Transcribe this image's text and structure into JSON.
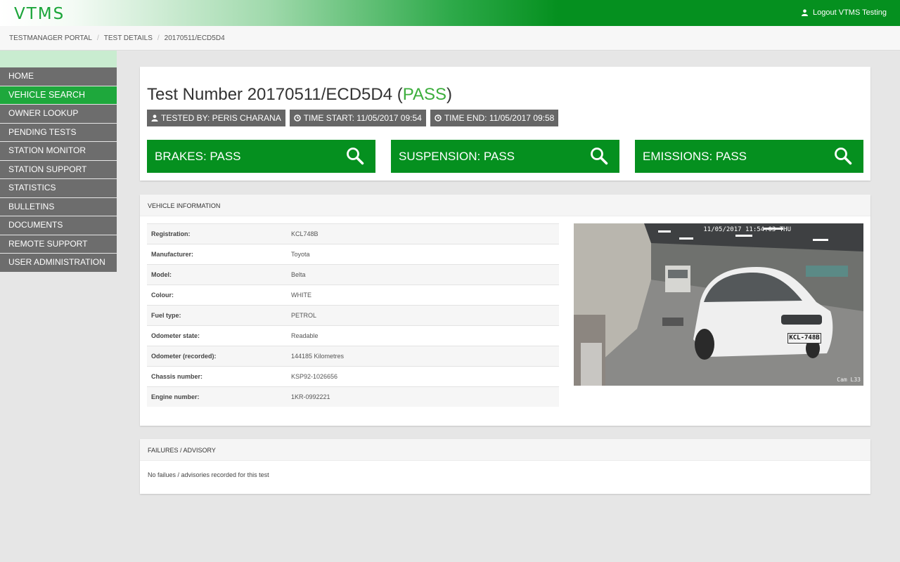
{
  "app": {
    "logo": "VTMS",
    "logout": "Logout VTMS Testing"
  },
  "breadcrumb": [
    "TESTMANAGER PORTAL",
    "TEST DETAILS",
    "20170511/ECD5D4"
  ],
  "sidebar": {
    "items": [
      {
        "label": "HOME",
        "active": false
      },
      {
        "label": "VEHICLE SEARCH",
        "active": true
      },
      {
        "label": "OWNER LOOKUP",
        "active": false
      },
      {
        "label": "PENDING TESTS",
        "active": false
      },
      {
        "label": "STATION MONITOR",
        "active": false
      },
      {
        "label": "STATION SUPPORT",
        "active": false
      },
      {
        "label": "STATISTICS",
        "active": false
      },
      {
        "label": "BULLETINS",
        "active": false
      },
      {
        "label": "DOCUMENTS",
        "active": false
      },
      {
        "label": "REMOTE SUPPORT",
        "active": false
      },
      {
        "label": "USER ADMINISTRATION",
        "active": false
      }
    ]
  },
  "test": {
    "title_prefix": "Test Number 20170511/ECD5D4 (",
    "status": "PASS",
    "title_suffix": ")",
    "tested_by": "TESTED BY: PERIS CHARANA",
    "time_start": "TIME START: 11/05/2017 09:54",
    "time_end": "TIME END: 11/05/2017 09:58",
    "results": [
      {
        "label": "BRAKES: PASS"
      },
      {
        "label": "SUSPENSION: PASS"
      },
      {
        "label": "EMISSIONS: PASS"
      }
    ]
  },
  "vehicle": {
    "header": "VEHICLE INFORMATION",
    "rows": [
      {
        "key": "Registration:",
        "value": "KCL748B"
      },
      {
        "key": "Manufacturer:",
        "value": "Toyota"
      },
      {
        "key": "Model:",
        "value": "Belta"
      },
      {
        "key": "Colour:",
        "value": "WHITE"
      },
      {
        "key": "Fuel type:",
        "value": "PETROL"
      },
      {
        "key": "Odometer state:",
        "value": "Readable"
      },
      {
        "key": "Odometer (recorded):",
        "value": "144185 Kilometres"
      },
      {
        "key": "Chassis number:",
        "value": "KSP92-1026656"
      },
      {
        "key": "Engine number:",
        "value": "1KR-0992221"
      }
    ],
    "camera": {
      "timestamp": "11/05/2017 11:54:03 THU",
      "cam_label": "Cam L33",
      "plate": "KCL-748B"
    }
  },
  "failures": {
    "header": "FAILURES / ADVISORY",
    "text": "No failues / advisories recorded for this test"
  },
  "colors": {
    "brand_green": "#05901f",
    "active_green": "#1ea83c",
    "nav_gray": "#6d6d6d",
    "pass_green": "#3cae3c"
  }
}
